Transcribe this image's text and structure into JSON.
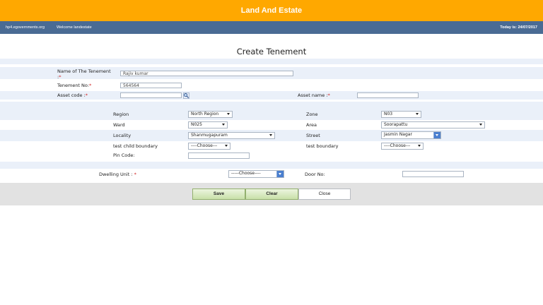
{
  "app": {
    "title": "Land And Estate"
  },
  "nav": {
    "site": "hp4.egovernments.org",
    "welcome": "Welcome landestate",
    "today": "Today is: 24/07/2017"
  },
  "page": {
    "title": "Create Tenement"
  },
  "form": {
    "tenement_name": {
      "label": "Name of The Tenement",
      "label_cont": ":",
      "req": "*",
      "value": "Rajiv kumar"
    },
    "tenement_no": {
      "label": "Tenement No:",
      "req": "*",
      "value": "564564"
    },
    "asset_code": {
      "label": "Asset code :",
      "req": "*",
      "value": ""
    },
    "asset_name": {
      "label": "Asset name :",
      "req": "*",
      "value": ""
    },
    "region": {
      "label": "Region",
      "value": "North Region"
    },
    "zone": {
      "label": "Zone",
      "value": "N03"
    },
    "ward": {
      "label": "Ward",
      "value": "N025"
    },
    "area": {
      "label": "Area",
      "value": "Soorapattu"
    },
    "locality": {
      "label": "Locality",
      "value": "Shanmugapuram"
    },
    "street": {
      "label": "Street",
      "value": "Jasmin Nagar"
    },
    "test_child_boundary": {
      "label": "test child boundary",
      "value": "----Choose---"
    },
    "test_boundary": {
      "label": "test boundary",
      "value": "----Choose---"
    },
    "pin_code": {
      "label": "Pin Code:",
      "value": ""
    },
    "dwelling_unit": {
      "label": "Dwelling Unit :",
      "req": "*",
      "value": "-----Choose----"
    },
    "door_no": {
      "label": "Door No:",
      "value": ""
    }
  },
  "buttons": {
    "save": "Save",
    "clear": "Clear",
    "close": "Close"
  },
  "colors": {
    "header": "#ffa800",
    "nav": "#4a6b94",
    "band": "#eaf0f9",
    "footer": "#e2e2e2"
  },
  "icons": {
    "asset_lookup": "magnifier-icon"
  }
}
